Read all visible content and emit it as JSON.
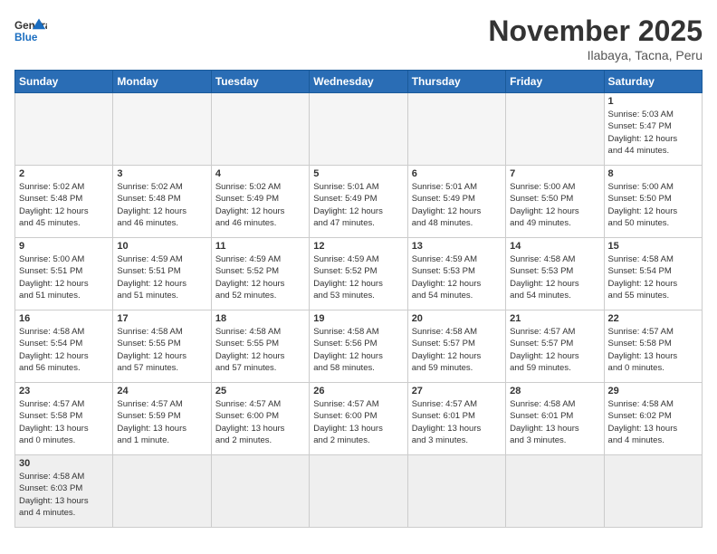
{
  "header": {
    "logo_general": "General",
    "logo_blue": "Blue",
    "month_title": "November 2025",
    "location": "Ilabaya, Tacna, Peru"
  },
  "weekdays": [
    "Sunday",
    "Monday",
    "Tuesday",
    "Wednesday",
    "Thursday",
    "Friday",
    "Saturday"
  ],
  "weeks": [
    [
      {
        "day": "",
        "info": ""
      },
      {
        "day": "",
        "info": ""
      },
      {
        "day": "",
        "info": ""
      },
      {
        "day": "",
        "info": ""
      },
      {
        "day": "",
        "info": ""
      },
      {
        "day": "",
        "info": ""
      },
      {
        "day": "1",
        "info": "Sunrise: 5:03 AM\nSunset: 5:47 PM\nDaylight: 12 hours\nand 44 minutes."
      }
    ],
    [
      {
        "day": "2",
        "info": "Sunrise: 5:02 AM\nSunset: 5:48 PM\nDaylight: 12 hours\nand 45 minutes."
      },
      {
        "day": "3",
        "info": "Sunrise: 5:02 AM\nSunset: 5:48 PM\nDaylight: 12 hours\nand 46 minutes."
      },
      {
        "day": "4",
        "info": "Sunrise: 5:02 AM\nSunset: 5:49 PM\nDaylight: 12 hours\nand 46 minutes."
      },
      {
        "day": "5",
        "info": "Sunrise: 5:01 AM\nSunset: 5:49 PM\nDaylight: 12 hours\nand 47 minutes."
      },
      {
        "day": "6",
        "info": "Sunrise: 5:01 AM\nSunset: 5:49 PM\nDaylight: 12 hours\nand 48 minutes."
      },
      {
        "day": "7",
        "info": "Sunrise: 5:00 AM\nSunset: 5:50 PM\nDaylight: 12 hours\nand 49 minutes."
      },
      {
        "day": "8",
        "info": "Sunrise: 5:00 AM\nSunset: 5:50 PM\nDaylight: 12 hours\nand 50 minutes."
      }
    ],
    [
      {
        "day": "9",
        "info": "Sunrise: 5:00 AM\nSunset: 5:51 PM\nDaylight: 12 hours\nand 51 minutes."
      },
      {
        "day": "10",
        "info": "Sunrise: 4:59 AM\nSunset: 5:51 PM\nDaylight: 12 hours\nand 51 minutes."
      },
      {
        "day": "11",
        "info": "Sunrise: 4:59 AM\nSunset: 5:52 PM\nDaylight: 12 hours\nand 52 minutes."
      },
      {
        "day": "12",
        "info": "Sunrise: 4:59 AM\nSunset: 5:52 PM\nDaylight: 12 hours\nand 53 minutes."
      },
      {
        "day": "13",
        "info": "Sunrise: 4:59 AM\nSunset: 5:53 PM\nDaylight: 12 hours\nand 54 minutes."
      },
      {
        "day": "14",
        "info": "Sunrise: 4:58 AM\nSunset: 5:53 PM\nDaylight: 12 hours\nand 54 minutes."
      },
      {
        "day": "15",
        "info": "Sunrise: 4:58 AM\nSunset: 5:54 PM\nDaylight: 12 hours\nand 55 minutes."
      }
    ],
    [
      {
        "day": "16",
        "info": "Sunrise: 4:58 AM\nSunset: 5:54 PM\nDaylight: 12 hours\nand 56 minutes."
      },
      {
        "day": "17",
        "info": "Sunrise: 4:58 AM\nSunset: 5:55 PM\nDaylight: 12 hours\nand 57 minutes."
      },
      {
        "day": "18",
        "info": "Sunrise: 4:58 AM\nSunset: 5:55 PM\nDaylight: 12 hours\nand 57 minutes."
      },
      {
        "day": "19",
        "info": "Sunrise: 4:58 AM\nSunset: 5:56 PM\nDaylight: 12 hours\nand 58 minutes."
      },
      {
        "day": "20",
        "info": "Sunrise: 4:58 AM\nSunset: 5:57 PM\nDaylight: 12 hours\nand 59 minutes."
      },
      {
        "day": "21",
        "info": "Sunrise: 4:57 AM\nSunset: 5:57 PM\nDaylight: 12 hours\nand 59 minutes."
      },
      {
        "day": "22",
        "info": "Sunrise: 4:57 AM\nSunset: 5:58 PM\nDaylight: 13 hours\nand 0 minutes."
      }
    ],
    [
      {
        "day": "23",
        "info": "Sunrise: 4:57 AM\nSunset: 5:58 PM\nDaylight: 13 hours\nand 0 minutes."
      },
      {
        "day": "24",
        "info": "Sunrise: 4:57 AM\nSunset: 5:59 PM\nDaylight: 13 hours\nand 1 minute."
      },
      {
        "day": "25",
        "info": "Sunrise: 4:57 AM\nSunset: 6:00 PM\nDaylight: 13 hours\nand 2 minutes."
      },
      {
        "day": "26",
        "info": "Sunrise: 4:57 AM\nSunset: 6:00 PM\nDaylight: 13 hours\nand 2 minutes."
      },
      {
        "day": "27",
        "info": "Sunrise: 4:57 AM\nSunset: 6:01 PM\nDaylight: 13 hours\nand 3 minutes."
      },
      {
        "day": "28",
        "info": "Sunrise: 4:58 AM\nSunset: 6:01 PM\nDaylight: 13 hours\nand 3 minutes."
      },
      {
        "day": "29",
        "info": "Sunrise: 4:58 AM\nSunset: 6:02 PM\nDaylight: 13 hours\nand 4 minutes."
      }
    ],
    [
      {
        "day": "30",
        "info": "Sunrise: 4:58 AM\nSunset: 6:03 PM\nDaylight: 13 hours\nand 4 minutes."
      },
      {
        "day": "",
        "info": ""
      },
      {
        "day": "",
        "info": ""
      },
      {
        "day": "",
        "info": ""
      },
      {
        "day": "",
        "info": ""
      },
      {
        "day": "",
        "info": ""
      },
      {
        "day": "",
        "info": ""
      }
    ]
  ]
}
